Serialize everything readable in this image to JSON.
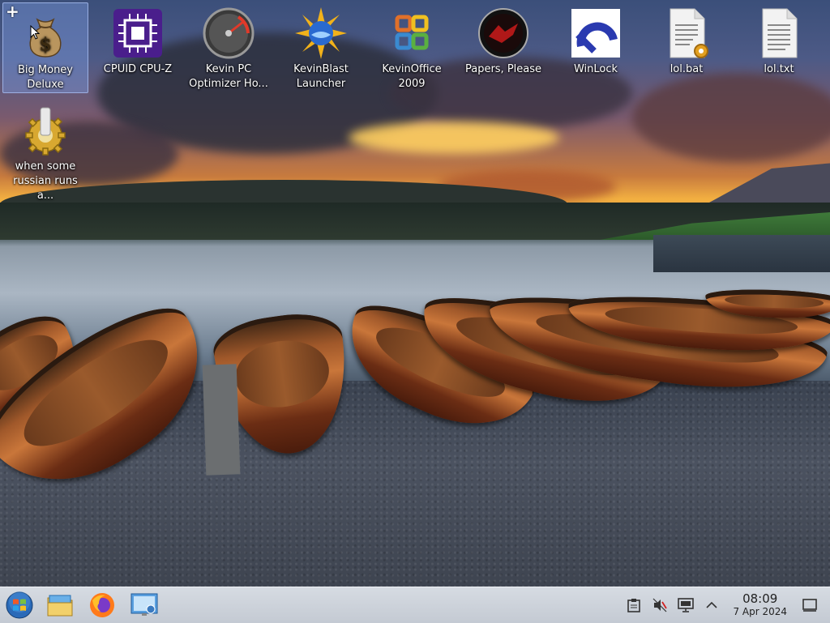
{
  "desktop": {
    "icons": [
      {
        "label": "Big Money Deluxe"
      },
      {
        "label": "CPUID CPU-Z"
      },
      {
        "label": "Kevin PC Optimizer Ho..."
      },
      {
        "label": "KevinBlast Launcher"
      },
      {
        "label": "KevinOffice 2009"
      },
      {
        "label": "Papers, Please"
      },
      {
        "label": "WinLock"
      },
      {
        "label": "lol.bat"
      },
      {
        "label": "lol.txt"
      },
      {
        "label": "when some russian runs a..."
      }
    ]
  },
  "taskbar": {
    "pinned": [
      "start-orb-icon",
      "file-manager-icon",
      "firefox-icon",
      "remote-desktop-icon"
    ],
    "tray": [
      "clipboard-icon",
      "volume-muted-icon",
      "display-icon",
      "chevron-up-icon"
    ],
    "clock": {
      "time": "08:09",
      "date": "7 Apr 2024"
    }
  },
  "colors": {
    "selection": "#7896dc",
    "taskbar": "#cdd2da"
  }
}
